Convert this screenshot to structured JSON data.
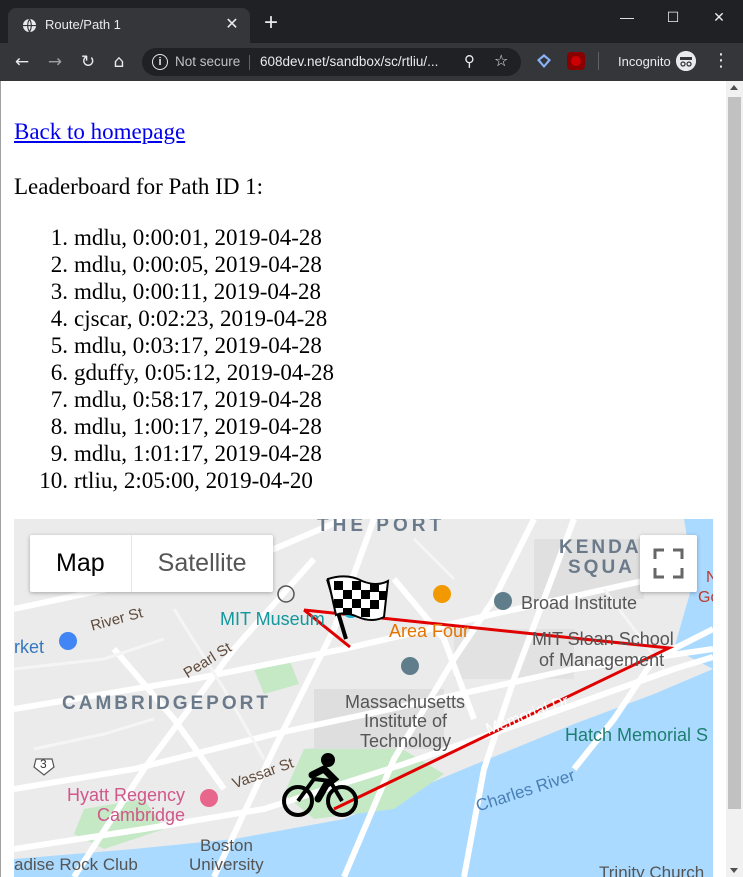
{
  "browser": {
    "tab_title": "Route/Path 1",
    "new_tab": "+",
    "omnibox": {
      "security_label": "Not secure",
      "url": "608dev.net/sandbox/sc/rtliu/..."
    },
    "profile_label": "Incognito"
  },
  "page": {
    "back_link": "Back to homepage",
    "heading": "Leaderboard for Path ID 1:",
    "leaderboard": [
      {
        "rank": "1.",
        "text": "mdlu, 0:00:01, 2019-04-28"
      },
      {
        "rank": "2.",
        "text": "mdlu, 0:00:05, 2019-04-28"
      },
      {
        "rank": "3.",
        "text": "mdlu, 0:00:11, 2019-04-28"
      },
      {
        "rank": "4.",
        "text": "cjscar, 0:02:23, 2019-04-28"
      },
      {
        "rank": "5.",
        "text": "mdlu, 0:03:17, 2019-04-28"
      },
      {
        "rank": "6.",
        "text": "gduffy, 0:05:12, 2019-04-28"
      },
      {
        "rank": "7.",
        "text": "mdlu, 0:58:17, 2019-04-28"
      },
      {
        "rank": "8.",
        "text": "mdlu, 1:00:17, 2019-04-28"
      },
      {
        "rank": "9.",
        "text": "mdlu, 1:01:17, 2019-04-28"
      },
      {
        "rank": "10.",
        "text": "rtliu, 2:05:00, 2019-04-20"
      }
    ]
  },
  "map": {
    "type_map": "Map",
    "type_satellite": "Satellite",
    "labels": {
      "the_port": "THE PORT",
      "kendall": "KENDA",
      "square": "SQUA",
      "river_st": "River St",
      "mit_museum": "MIT Museum",
      "broad": "Broad Institute",
      "area_four": "Area Four",
      "sloan_1": "MIT Sloan School",
      "sloan_2": "of Management",
      "market": "rket",
      "pearl_st": "Pearl St",
      "cambridgeport": "CAMBRIDGEPORT",
      "mit_1": "Massachusetts",
      "mit_2": "Institute of",
      "mit_3": "Technology",
      "memorial_dr": "Memorial Dr",
      "hatch": "Hatch Memorial S",
      "vassar_st": "Vassar St",
      "route_3": "3",
      "hyatt_1": "Hyatt Regency",
      "hyatt_2": "Cambridge",
      "charles_river": "Charles River",
      "boston_1": "Boston",
      "boston_2": "University",
      "paradise": "adise Rock Club",
      "trinity": "Trinity Church",
      "right_edge": "N",
      "right_edge2": "Go"
    },
    "colors": {
      "water": "#aadaff",
      "park": "#c5e8c5",
      "route": "#e00000"
    }
  }
}
